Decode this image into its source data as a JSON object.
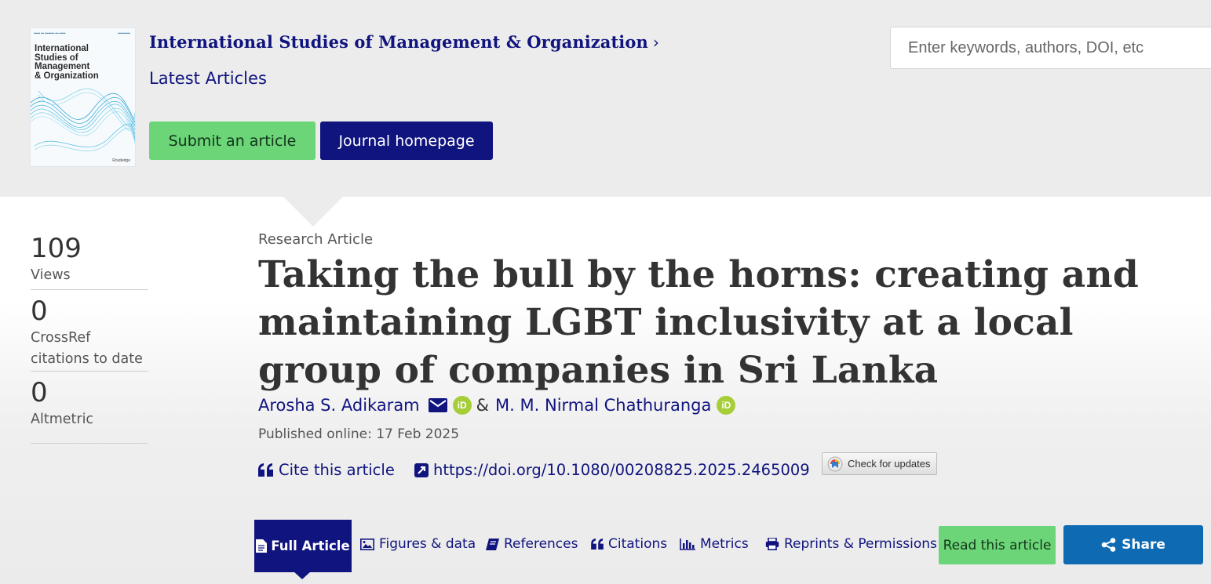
{
  "header": {
    "journal_title": "International Studies of Management & Organization",
    "latest_articles": "Latest Articles",
    "submit_button": "Submit an article",
    "journal_homepage_button": "Journal homepage",
    "search_placeholder": "Enter keywords, authors, DOI, etc",
    "cover": {
      "title": "International\nStudies of\nManagement\n& Organization",
      "publisher": "Routledge"
    }
  },
  "metrics": [
    {
      "value": "109",
      "label": "Views"
    },
    {
      "value": "0",
      "label": "CrossRef\ncitations to date"
    },
    {
      "value": "0",
      "label": "Altmetric"
    }
  ],
  "article": {
    "type": "Research Article",
    "title": "Taking the bull by the horns: creating and maintaining LGBT inclusivity at a local group of companies in Sri Lanka",
    "authors": [
      "Arosha S. Adikaram",
      "M. M. Nirmal Chathuranga"
    ],
    "author_separator": "&",
    "published": "Published online: 17 Feb 2025",
    "cite_label": "Cite this article",
    "doi": "https://doi.org/10.1080/00208825.2025.2465009",
    "check_updates": "Check for updates"
  },
  "tabs": {
    "full_article": "Full Article",
    "figures": "Figures & data",
    "references": "References",
    "citations": "Citations",
    "metrics": "Metrics",
    "reprints": "Reprints & Permissions",
    "read": "Read this article",
    "share": "Share"
  },
  "colors": {
    "brand_navy": "#10147e",
    "accent_green": "#6bd578",
    "share_blue": "#0d6ab3",
    "orcid_green": "#a6ce39",
    "header_bg": "#ececec"
  },
  "icons": [
    "chevron-right-icon",
    "mail-icon",
    "orcid-icon",
    "quote-icon",
    "external-link-icon",
    "document-icon",
    "image-icon",
    "book-icon",
    "bar-chart-icon",
    "printer-icon",
    "share-icon"
  ]
}
